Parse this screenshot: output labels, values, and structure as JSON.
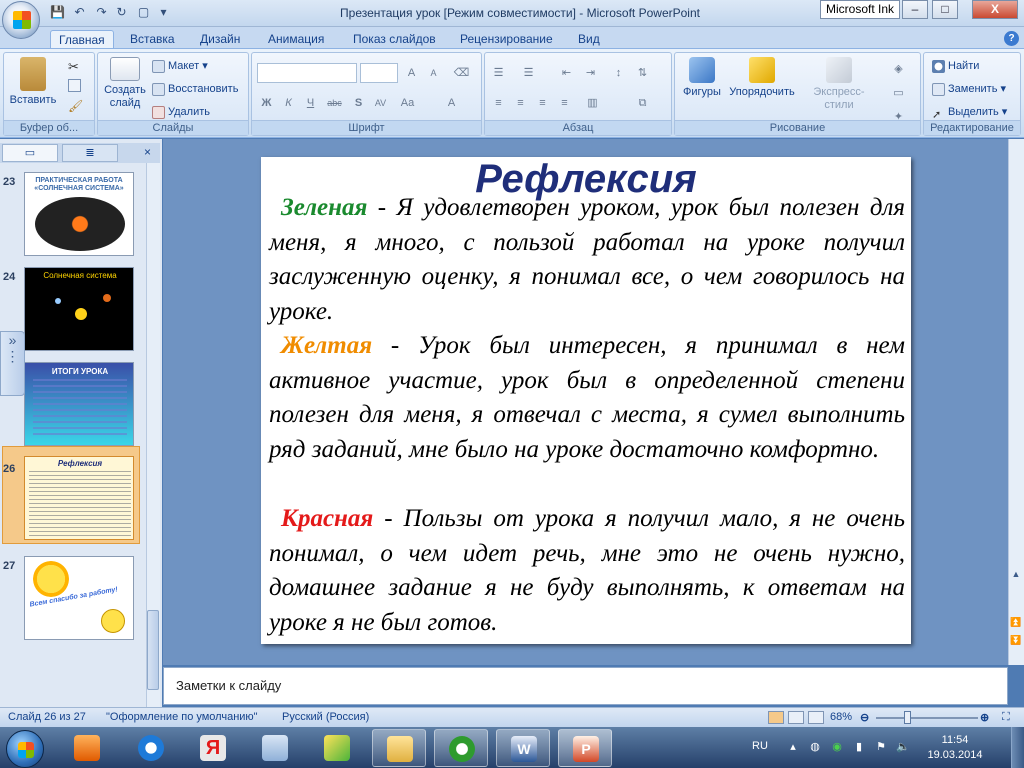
{
  "window": {
    "title": "Презентация урок [Режим совместимости] - Microsoft PowerPoint",
    "ink_button": "Microsoft Ink",
    "controls": {
      "minimize": "–",
      "maximize": "□",
      "close": "X"
    }
  },
  "tabs": [
    "Главная",
    "Вставка",
    "Дизайн",
    "Анимация",
    "Показ слайдов",
    "Рецензирование",
    "Вид"
  ],
  "ribbon": {
    "clipboard": {
      "label": "Буфер об...",
      "paste": "Вставить"
    },
    "slides": {
      "label": "Слайды",
      "create": "Создать слайд",
      "layout": "Макет",
      "reset": "Восстановить",
      "delete": "Удалить"
    },
    "font": {
      "label": "Шрифт",
      "bold": "Ж",
      "italic": "К",
      "underline": "Ч",
      "strike": "abc",
      "shadow": "S",
      "spacing": "AV",
      "case": "Aa",
      "color": "A",
      "grow": "A",
      "shrink": "A"
    },
    "paragraph": {
      "label": "Абзац"
    },
    "drawing": {
      "label": "Рисование",
      "shapes": "Фигуры",
      "arrange": "Упорядочить",
      "styles": "Экспресс-стили"
    },
    "editing": {
      "label": "Редактирование",
      "find": "Найти",
      "replace": "Заменить",
      "select": "Выделить"
    }
  },
  "slides_panel": {
    "thumbs": [
      {
        "num": "23",
        "title": "ПРАКТИЧЕСКАЯ РАБОТА «СОЛНЕЧНАЯ СИСТЕМА»"
      },
      {
        "num": "24",
        "title": "Солнечная система"
      },
      {
        "num": "25",
        "title": "ИТОГИ УРОКА"
      },
      {
        "num": "26",
        "title": "Рефлексия"
      },
      {
        "num": "27",
        "title": "Всем спасибо за работу!"
      }
    ]
  },
  "slide": {
    "title": "Рефлексия",
    "items": [
      {
        "keyword": "Зеленая",
        "color": "#1a8a2e",
        "text": " - Я удовлетворен уроком, урок был полезен для меня, я много, с пользой работал на уроке получил заслуженную оценку, я понимал все, о чем говорилось на уроке."
      },
      {
        "keyword": "Желтая",
        "color": "#f08c00",
        "text": " - Урок был интересен, я принимал в нем активное участие, урок был в определенной степени полезен для меня, я отвечал с места, я сумел выполнить ряд заданий, мне было на уроке достаточно комфортно."
      },
      {
        "keyword": "Красная",
        "color": "#e41a1a",
        "text": " - Пользы от урока я получил мало, я не очень понимал, о чем идет речь, мне это не очень нужно, домашнее задание я не буду выполнять, к ответам на уроке я не был готов."
      }
    ]
  },
  "notes": {
    "placeholder": "Заметки к слайду"
  },
  "status": {
    "slide": "Слайд 26 из 27",
    "theme": "\"Оформление по умолчанию\"",
    "language": "Русский (Россия)",
    "zoom": "68%"
  },
  "taskbar": {
    "lang": "RU",
    "time": "11:54",
    "date": "19.03.2014"
  }
}
